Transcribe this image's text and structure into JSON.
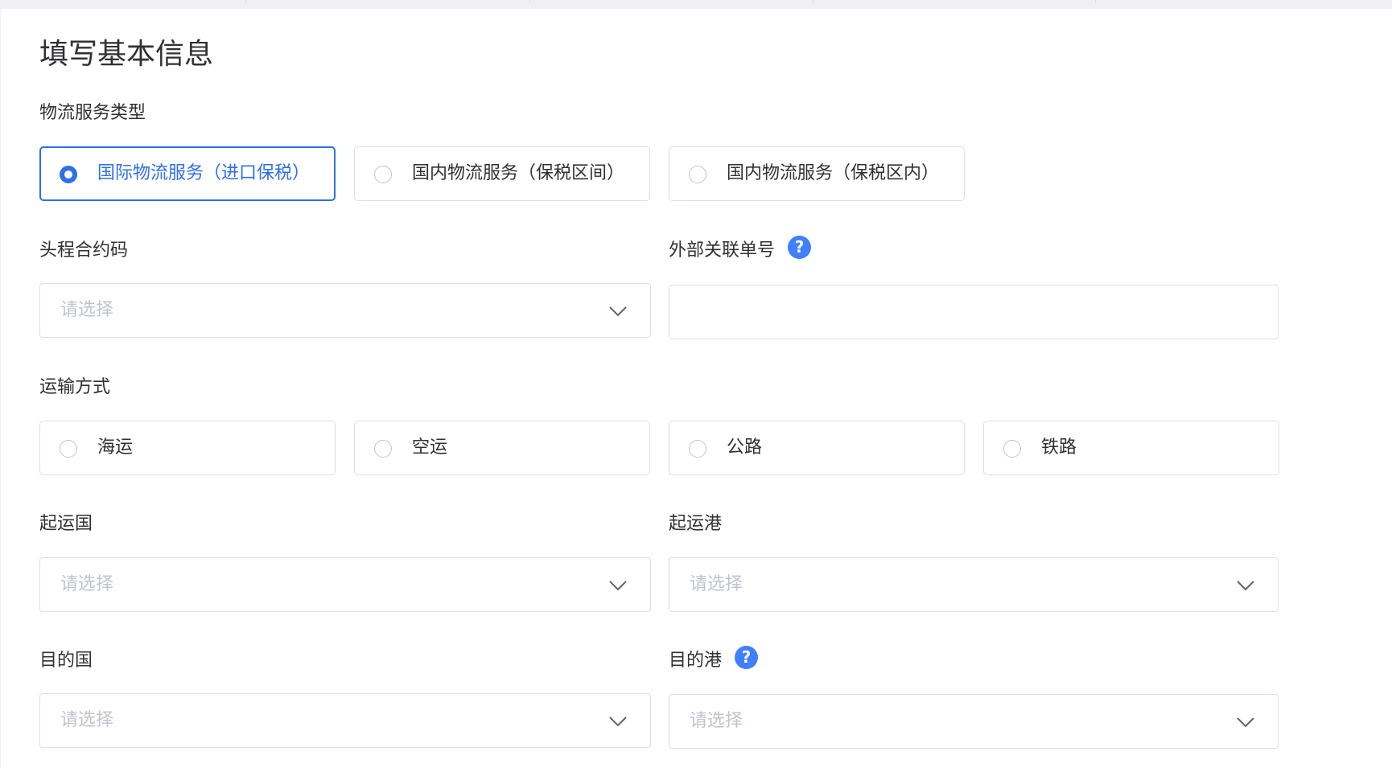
{
  "page_title": "填写基本信息",
  "service_type": {
    "label": "物流服务类型",
    "options": [
      {
        "label": "国际物流服务（进口保税）",
        "selected": true
      },
      {
        "label": "国内物流服务（保税区间）",
        "selected": false
      },
      {
        "label": "国内物流服务（保税区内）",
        "selected": false
      }
    ]
  },
  "contract_code": {
    "label": "头程合约码",
    "placeholder": "请选择"
  },
  "external_ref": {
    "label": "外部关联单号",
    "help": "?",
    "value": ""
  },
  "transport_mode": {
    "label": "运输方式",
    "options": [
      {
        "label": "海运",
        "selected": false
      },
      {
        "label": "空运",
        "selected": false
      },
      {
        "label": "公路",
        "selected": false
      },
      {
        "label": "铁路",
        "selected": false
      }
    ]
  },
  "origin_country": {
    "label": "起运国",
    "placeholder": "请选择"
  },
  "origin_port": {
    "label": "起运港",
    "placeholder": "请选择"
  },
  "dest_country": {
    "label": "目的国",
    "placeholder": "请选择"
  },
  "dest_port": {
    "label": "目的港",
    "help": "?",
    "placeholder": "请选择"
  },
  "colors": {
    "accent": "#2f6fe8",
    "help_icon": "#4080ff",
    "border": "#dcdfe6",
    "placeholder": "#c0c4cc"
  }
}
